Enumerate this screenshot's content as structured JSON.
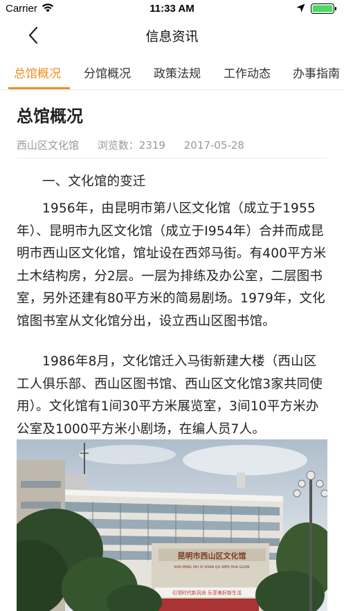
{
  "status_bar": {
    "carrier": "Carrier",
    "time": "11:33 AM",
    "icons": [
      "wifi-icon",
      "location-arrow-icon",
      "battery-icon"
    ],
    "battery_color": "#4cd964"
  },
  "nav": {
    "title": "信息资讯",
    "back_icon": "chevron-left-icon"
  },
  "tabs": [
    {
      "label": "总馆概况",
      "active": true
    },
    {
      "label": "分馆概况",
      "active": false
    },
    {
      "label": "政策法规",
      "active": false
    },
    {
      "label": "工作动态",
      "active": false
    },
    {
      "label": "办事指南",
      "active": false
    }
  ],
  "accent_color": "#f08c1e",
  "article": {
    "title": "总馆概况",
    "source": "西山区文化馆",
    "views": "浏览数：2319",
    "date": "2017-05-28",
    "paragraphs": [
      "一、文化馆的变迁",
      "1956年，由昆明市第八区文化馆（成立于1955年）、昆明市九区文化馆（成立于I954年）合并而成昆明市西山区文化馆，馆址设在西郊马街。有400平方米土木结构房，分2层。一层为排练及办公室，二层图书室，另外还建有80平方米的简易剧场。1979年，文化馆图书室从文化馆分出，设立西山区图书馆。",
      "1986年8月，文化馆迁入马街新建大楼（西山区工人俱乐部、西山区图书馆、西山区文化馆3家共同使用）。文化馆有1间30平方米展览室，3间10平方米办公室及1000平方米小剧场，在编人员7人。"
    ],
    "photo_sign": "昆明市西山区文化馆",
    "photo_sign_pinyin": "KUN MING SHI XI SHAN QU WEN HUA GUAN",
    "photo_banner": "引领时代新风尚  乐享美好新生活"
  }
}
